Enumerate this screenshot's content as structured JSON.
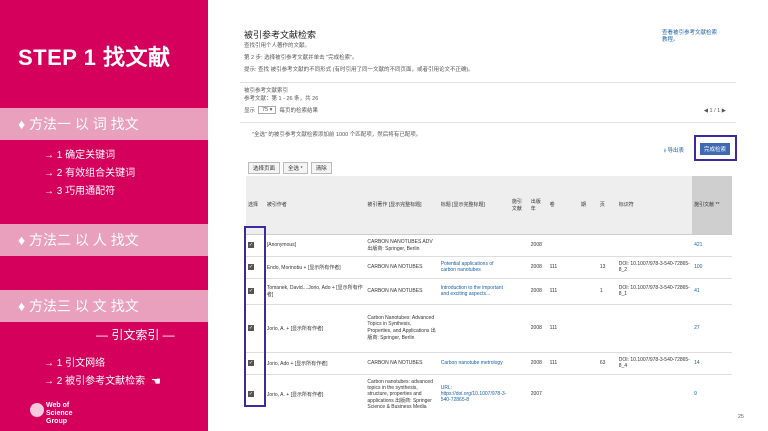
{
  "left": {
    "step_title": "STEP 1  找文献",
    "method1": "♦ 方法一  以 词 找文",
    "method1_items": [
      "→  1 确定关键词",
      "→  2 有效组合关键词",
      "→  3 巧用通配符"
    ],
    "method2": "♦ 方法二  以 人 找文",
    "method3": "♦ 方法三  以 文 找文",
    "ref_index": "— 引文索引 —",
    "method3_items": [
      "→  1 引文网络",
      "→  2 被引参考文献检索"
    ],
    "hand_icon": "hand-pointing-icon",
    "logo_text": [
      "Web of",
      "Science",
      "Group"
    ]
  },
  "page_number": "25",
  "screenshot": {
    "title": "被引参考文献检索",
    "subtitle": "查找引用个人著作的文献。",
    "step2": "第 2 步: 选择被引参考文献并单击 \"完成检索\"。",
    "tip": "提示: 查找 被引参考文献的不同形式 (有时引用了同一文献的不同页面，或者引用论文不正确)。",
    "right_link": "查看被引参考文献检索教程。",
    "index_label": "被引参考文献索引",
    "refs_count": "参考文献：第 1 - 26 条，共 26",
    "show_label": "显示",
    "per_page": "75",
    "per_page_suffix": "每页的检索结果",
    "pager": "◀  1  / 1  ▶",
    "note": "\"全选\" 的被引参考文献检索添加前 1000 个匹配项，然后将有已配项。",
    "export": "导出表",
    "finish_button": "完成检索",
    "toolbar": [
      "选择页面",
      "全选 *",
      "清除"
    ],
    "columns": [
      "选择",
      "被引作者",
      "被引著作\n[显示完整标题]",
      "标题\n[显示完整标题]",
      "施引文献",
      "出版年",
      "卷",
      "期",
      "页",
      "标识符",
      "施引文献 **"
    ],
    "rows": [
      {
        "author": "[Anonymous]",
        "work": "CARBON NANOTUBES ADV\n出版商: Springer, Berlin",
        "title": "",
        "year": "2008",
        "vol": "",
        "issue": "",
        "page": "",
        "id": "",
        "count": "421"
      },
      {
        "author": "Endo, Morinobu\n+ [显示所有作者]",
        "work": "CARBON NA NOTUBES",
        "title": "Potential applications of carbon nanotubes",
        "year": "2008",
        "vol": "111",
        "issue": "",
        "page": "13",
        "id": "DOI: 10.1007/978-3-540-72865-8_2",
        "count": "100"
      },
      {
        "author": "Tomanek, David....Jorio, Ado\n+ [显示所有作者]",
        "work": "CARBON NA NOTUBES",
        "title": "Introduction to the important and exciting aspects...",
        "year": "2008",
        "vol": "111",
        "issue": "",
        "page": "1",
        "id": "DOI: 10.1007/978-3-540-72865-8_1",
        "count": "41"
      },
      {
        "author": "Jorio, A.\n+ [显示所有作者]",
        "work": "Carbon Nanotubes: Advanced Topics in Synthesis, Properties, and Applications\n出版商: Springer, Berlin",
        "title": "",
        "year": "2008",
        "vol": "111",
        "issue": "",
        "page": "",
        "id": "",
        "count": "27"
      },
      {
        "author": "Jorio, Ado\n+ [显示所有作者]",
        "work": "CARBON NA NOTUBES",
        "title": "Carbon nanotube metrology",
        "year": "2008",
        "vol": "111",
        "issue": "",
        "page": "63",
        "id": "DOI: 10.1007/978-3-540-72865-8_4",
        "count": "14"
      },
      {
        "author": "Jorio, A.\n+ [显示所有作者]",
        "work": "Carbon nanotubes: advanced topics in the synthesis, structure, properties and applications\n出版商: Springer Science & Business Media",
        "title": "URL: https://doi.org/10.1007/978-3-540-72865-8",
        "year": "2007",
        "vol": "",
        "issue": "",
        "page": "",
        "id": "",
        "count": "9"
      }
    ]
  }
}
